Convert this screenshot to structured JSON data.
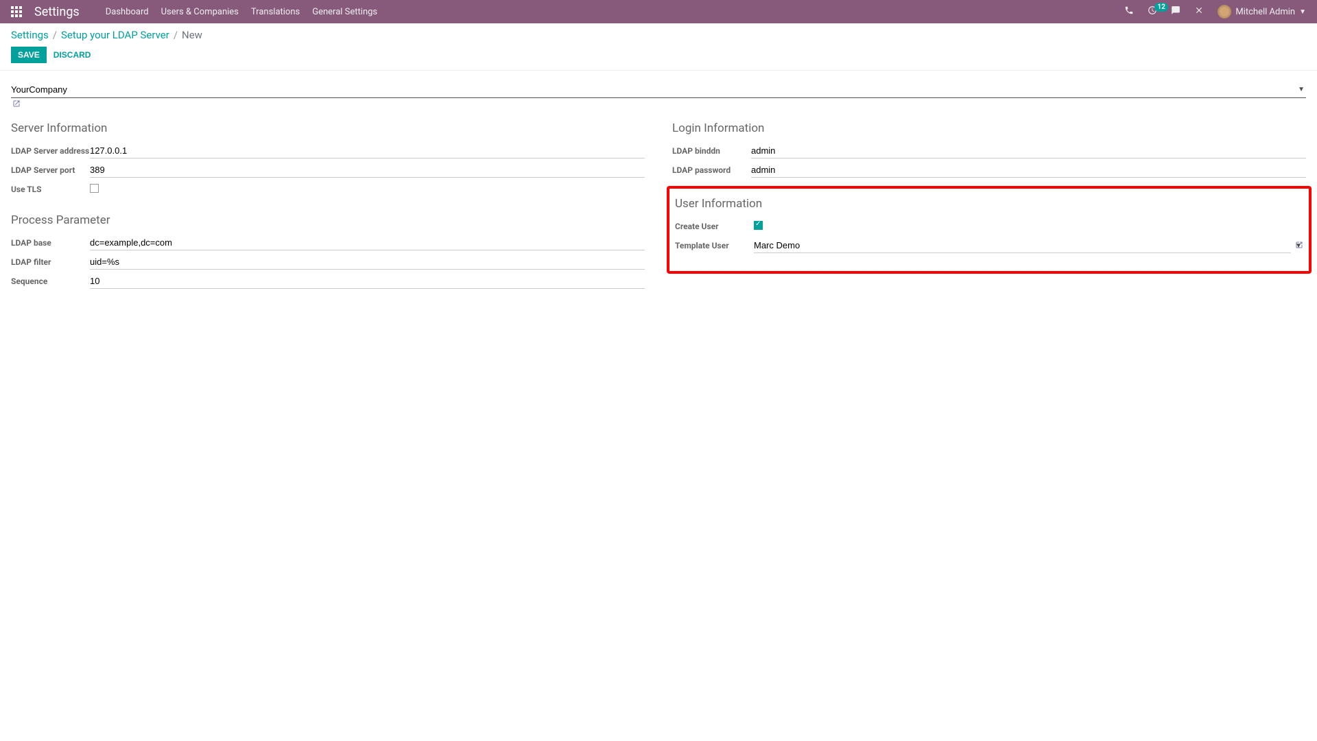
{
  "navbar": {
    "app_title": "Settings",
    "menu": [
      "Dashboard",
      "Users & Companies",
      "Translations",
      "General Settings"
    ],
    "activity_count": "12",
    "user_name": "Mitchell Admin"
  },
  "breadcrumb": {
    "items": [
      "Settings",
      "Setup your LDAP Server"
    ],
    "current": "New"
  },
  "buttons": {
    "save": "Save",
    "discard": "Discard"
  },
  "company": {
    "value": "YourCompany"
  },
  "sections": {
    "server_info": {
      "title": "Server Information",
      "fields": {
        "address": {
          "label": "LDAP Server address",
          "value": "127.0.0.1"
        },
        "port": {
          "label": "LDAP Server port",
          "value": "389"
        },
        "tls": {
          "label": "Use TLS",
          "checked": false
        }
      }
    },
    "process_param": {
      "title": "Process Parameter",
      "fields": {
        "base": {
          "label": "LDAP base",
          "value": "dc=example,dc=com"
        },
        "filter": {
          "label": "LDAP filter",
          "value": "uid=%s"
        },
        "sequence": {
          "label": "Sequence",
          "value": "10"
        }
      }
    },
    "login_info": {
      "title": "Login Information",
      "fields": {
        "binddn": {
          "label": "LDAP binddn",
          "value": "admin"
        },
        "password": {
          "label": "LDAP password",
          "value": "admin"
        }
      }
    },
    "user_info": {
      "title": "User Information",
      "fields": {
        "create_user": {
          "label": "Create User",
          "checked": true
        },
        "template_user": {
          "label": "Template User",
          "value": "Marc Demo"
        }
      }
    }
  }
}
